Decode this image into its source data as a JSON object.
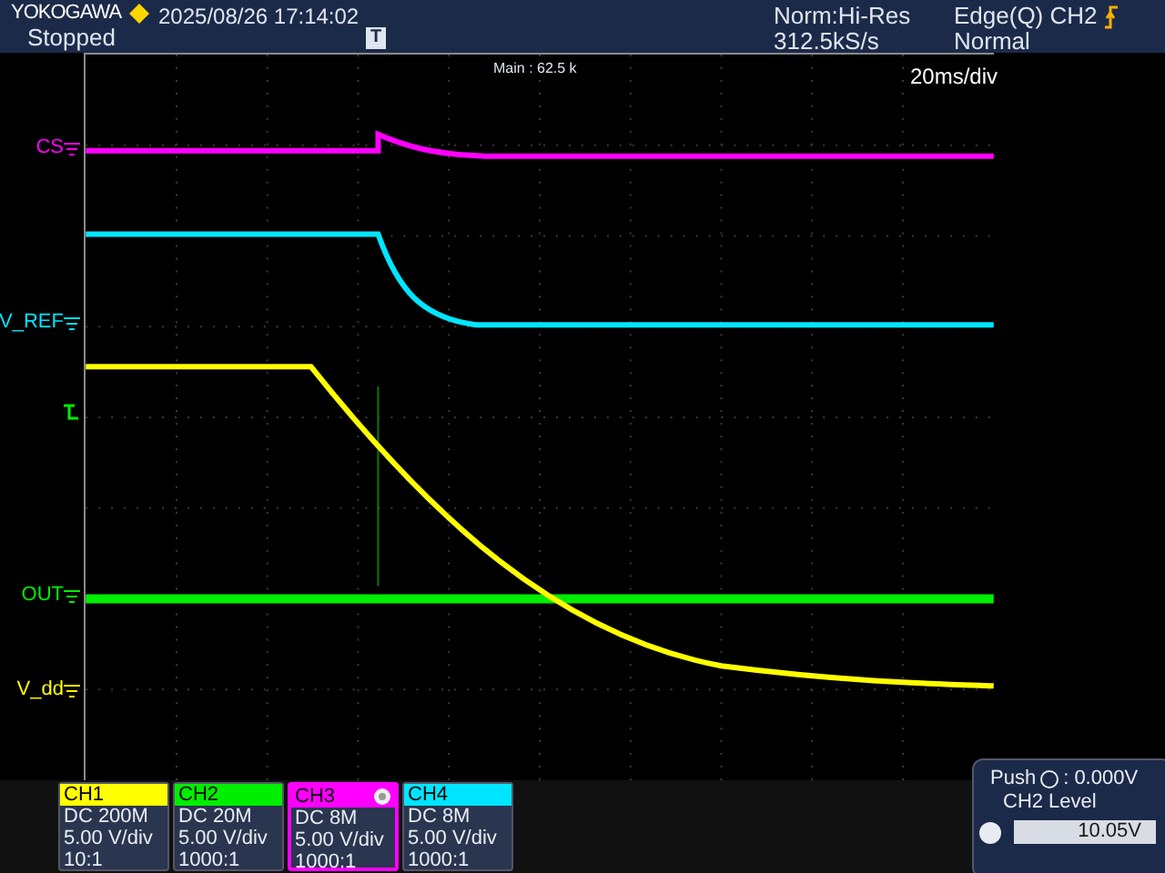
{
  "header": {
    "brand": "YOKOGAWA",
    "timestamp": "2025/08/26 17:14:02",
    "run_state": "Stopped",
    "acquisition": "Norm:Hi-Res",
    "sample_rate": "312.5kS/s",
    "trigger": "Edge(Q) CH2",
    "trigger_mode": "Normal",
    "trigger_marker": "T"
  },
  "plot": {
    "zoom_label": "Main : 62.5 k",
    "timebase": "20ms/div"
  },
  "traces": [
    {
      "label": "CS",
      "color": "#ff00ff",
      "kind": "step_decay"
    },
    {
      "label": "V_REF",
      "color": "#00e5ff",
      "kind": "drop_decay"
    },
    {
      "label": "OUT",
      "color": "#00ee00",
      "kind": "flat"
    },
    {
      "label": "V_dd",
      "color": "#ffff00",
      "kind": "slow_decay"
    }
  ],
  "trigger_level": {
    "color": "#00ee00"
  },
  "channels": [
    {
      "name": "CH1",
      "coupling": "DC 200M",
      "scale": "5.00 V/div",
      "probe": "10:1",
      "color": "#ffff00",
      "selected": false
    },
    {
      "name": "CH2",
      "coupling": "DC 20M",
      "scale": "5.00 V/div",
      "probe": "1000:1",
      "color": "#00ee00",
      "selected": false
    },
    {
      "name": "CH3",
      "coupling": "DC 8M",
      "scale": "5.00 V/div",
      "probe": "1000:1",
      "color": "#ff00ff",
      "selected": true
    },
    {
      "name": "CH4",
      "coupling": "DC 8M",
      "scale": "5.00 V/div",
      "probe": "1000:1",
      "color": "#00e5ff",
      "selected": false
    }
  ],
  "level_panel": {
    "push_label": "Push",
    "push_value": ": 0.000V",
    "title": "CH2 Level",
    "value": "10.05V"
  }
}
